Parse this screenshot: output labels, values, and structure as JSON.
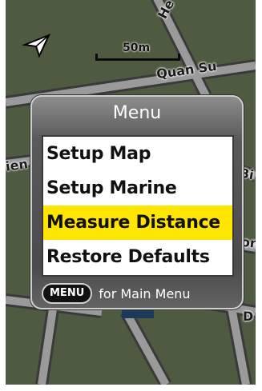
{
  "map": {
    "scale_label": "50m",
    "streets": {
      "he": "He",
      "quan_su": "Quan Su",
      "left_cut": "ien",
      "right_cut_1": "Bi",
      "right_cut_2": "on",
      "right_cut_3": "D"
    }
  },
  "menu": {
    "title": "Menu",
    "items": [
      {
        "label": "Setup Map",
        "selected": false
      },
      {
        "label": "Setup Marine",
        "selected": false
      },
      {
        "label": "Measure Distance",
        "selected": true
      },
      {
        "label": "Restore Defaults",
        "selected": false
      }
    ],
    "key_label": "MENU",
    "hint": "for Main Menu",
    "highlight_color": "#ffe600"
  },
  "icons": [
    "navigation-arrow-icon",
    "menu-key-icon"
  ]
}
